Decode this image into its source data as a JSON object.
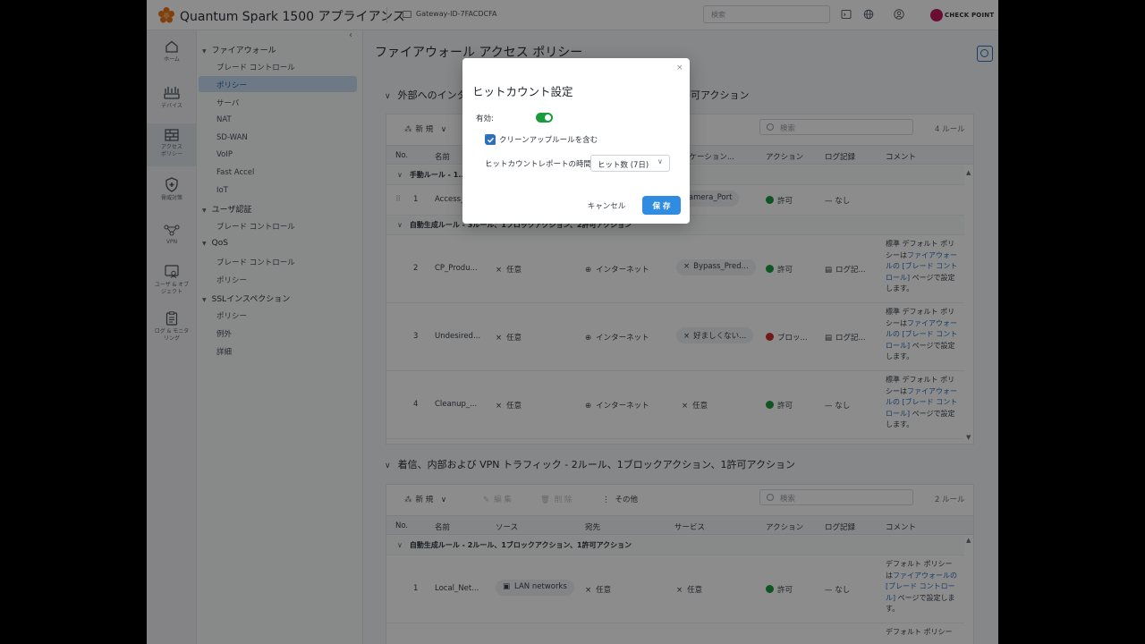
{
  "header": {
    "app_title": "Quantum Spark 1500 アプライアンス",
    "gateway_id": "Gateway-ID-7FACDCFA",
    "search_placeholder": "検索",
    "brand": "CHECK POINT",
    "brand_color": "#c2185b"
  },
  "leftnav": {
    "items": [
      {
        "label": "ホーム",
        "icon": "home-icon"
      },
      {
        "label": "デバイス",
        "icon": "device-icon"
      },
      {
        "label": "アクセス ポリシー",
        "icon": "access-policy-icon",
        "active": true
      },
      {
        "label": "脅威対策",
        "icon": "shield-icon"
      },
      {
        "label": "VPN",
        "icon": "vpn-icon"
      },
      {
        "label": "ユーザ & オブジェクト",
        "icon": "users-objects-icon"
      },
      {
        "label": "ログ & モニタリング",
        "icon": "logs-icon"
      }
    ]
  },
  "tree": {
    "firewall": "ファイアウォール",
    "fw_blade": "ブレード コントロール",
    "fw_policy": "ポリシー",
    "fw_servers": "サーバ",
    "fw_nat": "NAT",
    "fw_sdwan": "SD-WAN",
    "fw_voip": "VoIP",
    "fw_fastaccel": "Fast Accel",
    "fw_iot": "IoT",
    "userauth": "ユーザ認証",
    "ua_blade": "ブレード コントロール",
    "qos": "QoS",
    "qos_blade": "ブレード コントロール",
    "qos_policy": "ポリシー",
    "ssl": "SSLインスペクション",
    "ssl_policy": "ポリシー",
    "ssl_exceptions": "例外",
    "ssl_advanced": "詳細"
  },
  "main": {
    "page_title": "ファイアウォール アクセス ポリシー",
    "section1": {
      "title_left": "外部へのインタ",
      "title_right": "許可アクション",
      "new_label": "新 規",
      "search_placeholder": "検索",
      "rule_count": "4 ルール",
      "columns": {
        "no": "No.",
        "name": "名前",
        "application": "リケーション...",
        "action": "アクション",
        "log": "ログ記録",
        "comment": "コメント"
      },
      "group_manual": "手動ルール - 1...",
      "group_auto": "自動生成ルール - 3ルール、1ブロックアクション、2許可アクション",
      "rows": [
        {
          "no": "1",
          "name": "Access_",
          "app": "Camera_Port",
          "action": "許可",
          "log": "なし"
        },
        {
          "no": "2",
          "name": "CP_Produ...",
          "source": "任意",
          "dest": "インターネット",
          "app": "Bypass_Pred...",
          "action": "許可",
          "log": "ログ記...",
          "comment_a": "標準 デフォルト ポリシーは",
          "comment_link": "ファイアウォールの [ブレード コントロール]",
          "comment_b": " ページで設定します。"
        },
        {
          "no": "3",
          "name": "Undesired...",
          "source": "任意",
          "dest": "インターネット",
          "app": "好ましくない...",
          "action": "ブロッ...",
          "log": "ログ記...",
          "comment_a": "標準 デフォルト ポリシーは",
          "comment_link": "ファイアウォールの [ブレード コントロール]",
          "comment_b": " ページで設定します。"
        },
        {
          "no": "4",
          "name": "Cleanup_...",
          "source": "任意",
          "dest": "インターネット",
          "app": "任意",
          "action": "許可",
          "log": "なし",
          "comment_a": "標準 デフォルト ポリシーは",
          "comment_link": "ファイアウォールの [ブレード コントロール]",
          "comment_b": " ページで設定します。"
        }
      ]
    },
    "section2": {
      "title": "着信、内部および VPN トラフィック - 2ルール、1ブロックアクション、1許可アクション",
      "new_label": "新 規",
      "edit_label": "編 集",
      "delete_label": "削 除",
      "more_label": "その他",
      "search_placeholder": "検索",
      "rule_count": "2 ルール",
      "columns": {
        "no": "No.",
        "name": "名前",
        "source": "ソース",
        "dest": "宛先",
        "service": "サービス",
        "action": "アクション",
        "log": "ログ記録",
        "comment": "コメント"
      },
      "group_auto": "自動生成ルール - 2ルール、1ブロックアクション、1許可アクション",
      "rows": [
        {
          "no": "1",
          "name": "Local_Net...",
          "source": "LAN networks",
          "dest": "任意",
          "service": "任意",
          "action": "許可",
          "log": "なし",
          "comment_a": "デフォルト ポリシーは",
          "comment_link": "ファイアウォールの [ブレード コントロール]",
          "comment_b": " ページで設定します。"
        },
        {
          "comment_a": "デフォルト ポリシー"
        }
      ]
    }
  },
  "modal": {
    "title": "ヒットカウント設定",
    "enabled_label": "有効:",
    "enabled": true,
    "cleanup_label": "クリーンアップルールを含む",
    "cleanup_checked": true,
    "period_label": "ヒットカウントレポートの時間",
    "period_value": "ヒット数 (7日)",
    "cancel": "キャンセル",
    "save": "保 存",
    "accent_color": "#2f8ce0",
    "toggle_color": "#1a9c3e"
  }
}
